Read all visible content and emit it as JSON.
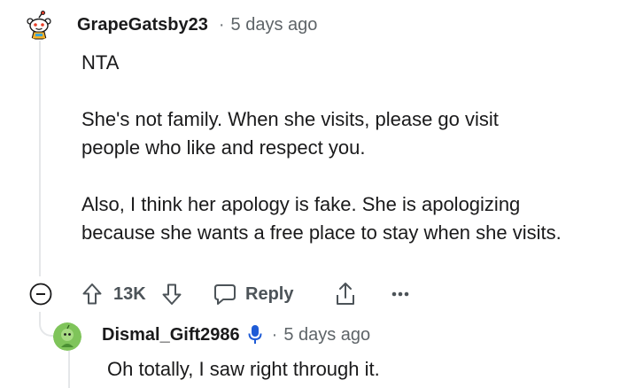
{
  "comment": {
    "username": "GrapeGatsby23",
    "separator": "·",
    "time": "5 days ago",
    "avatar_icon": "snoo-avatar-icon",
    "paragraphs": [
      "NTA",
      "She's not family. When she visits, please go visit people who like and respect you.",
      "Also, I think her apology is fake. She is apologizing because she wants a free place to stay when she visits."
    ],
    "actions": {
      "collapse_icon": "collapse-minus-icon",
      "upvote_icon": "upvote-arrow-icon",
      "vote_count": "13K",
      "downvote_icon": "downvote-arrow-icon",
      "reply_icon": "chat-bubble-icon",
      "reply_label": "Reply",
      "share_icon": "share-icon",
      "more_icon": "more-options-icon"
    }
  },
  "reply": {
    "username": "Dismal_Gift2986",
    "op_icon": "microphone-icon",
    "separator": "·",
    "time": "5 days ago",
    "avatar_icon": "green-snoo-avatar-icon",
    "text": "Oh totally, I saw right through it."
  },
  "colors": {
    "text": "#1a1a1b",
    "meta": "#5e6468",
    "action": "#4c5358",
    "op_badge": "#1e5bd6",
    "thread_line": "#e5e7e9"
  }
}
